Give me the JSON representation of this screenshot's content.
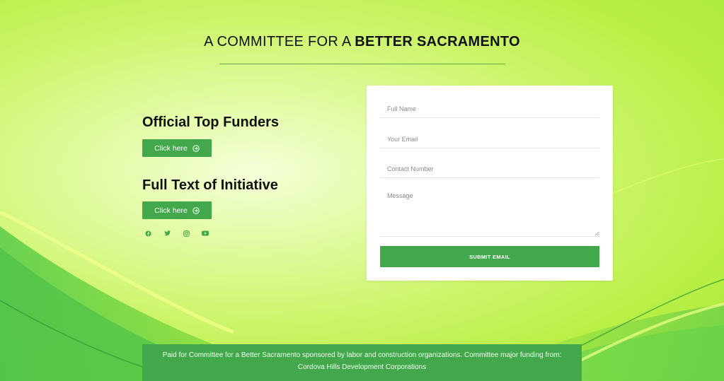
{
  "header": {
    "title_light": "A COMMITTEE FOR A ",
    "title_bold": "BETTER SACRAMENTO"
  },
  "sections": [
    {
      "heading": "Official Top Funders",
      "button_label": "Click here",
      "button_icon": "arrow-circle-right-icon"
    },
    {
      "heading": "Full Text of Initiative",
      "button_label": "Click here",
      "button_icon": "arrow-circle-right-icon"
    }
  ],
  "social": [
    "facebook-icon",
    "twitter-icon",
    "instagram-icon",
    "youtube-icon"
  ],
  "form": {
    "full_name_placeholder": "Full Name",
    "email_placeholder": "Your Email",
    "contact_placeholder": "Contact Number",
    "message_placeholder": "Message",
    "submit_label": "SUBMIT EMAIL"
  },
  "footer": {
    "text": "Paid for Committee for a Better Sacramento sponsored by labor and construction organizations. Committee major funding from: Cordova Hills Development Corporations"
  },
  "colors": {
    "accent_green": "#43a84b",
    "background_lime": "#c8f45a"
  }
}
